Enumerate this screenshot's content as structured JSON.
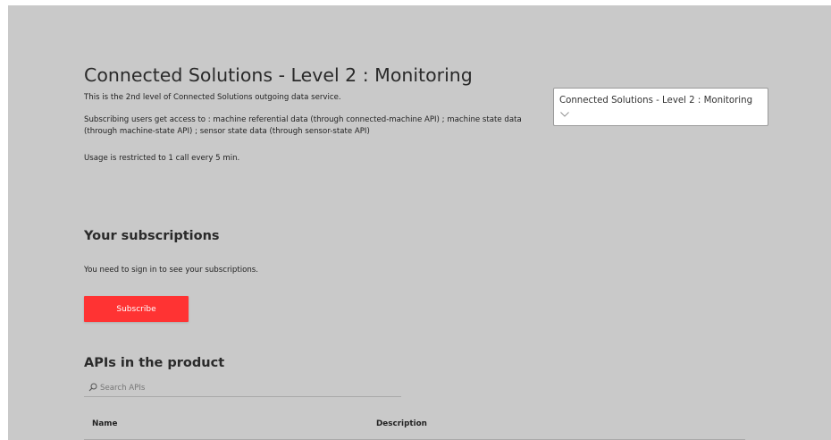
{
  "product": {
    "title": "Connected Solutions - Level 2 : Monitoring",
    "description_1": "This is the 2nd level of Connected Solutions outgoing data service.",
    "description_2": "Subscribing users get access to : machine referential data (through connected-machine API) ; machine state data (through machine-state API) ; sensor state data (through sensor-state API)",
    "description_3": "Usage is restricted to 1 call every 5 min."
  },
  "product_selector": {
    "selected": "Connected Solutions - Level 2 : Monitoring",
    "icon": "chevron-down-icon"
  },
  "subscriptions": {
    "title": "Your subscriptions",
    "signin_message": "You need to sign in to see your subscriptions.",
    "subscribe_label": "Subscribe"
  },
  "apis": {
    "title": "APIs in the product",
    "search_placeholder": "Search APIs",
    "search_icon": "search-icon",
    "columns": [
      "Name",
      "Description"
    ]
  },
  "colors": {
    "page_background": "#c9c9c9",
    "accent": "#ff3333"
  }
}
